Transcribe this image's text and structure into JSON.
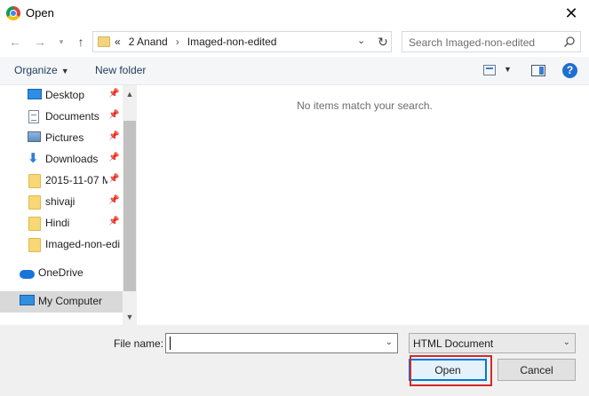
{
  "window": {
    "title": "Open",
    "icon": "chrome-icon",
    "close_icon": "close-icon"
  },
  "navbar": {
    "back_icon": "arrow-left-icon",
    "forward_icon": "arrow-right-icon",
    "recent_icon": "chevron-down-icon",
    "up_icon": "arrow-up-icon",
    "breadcrumb_prefix": "«",
    "breadcrumb": [
      "2 Anand",
      "Imaged-non-edited"
    ],
    "breadcrumb_sep": "›",
    "search_placeholder": "Search Imaged-non-edited"
  },
  "toolbar": {
    "organize_label": "Organize",
    "new_folder_label": "New folder"
  },
  "sidebar": {
    "items": [
      {
        "label": "Desktop",
        "icon": "desktop-icon",
        "pinned": true
      },
      {
        "label": "Documents",
        "icon": "documents-icon",
        "pinned": true
      },
      {
        "label": "Pictures",
        "icon": "pictures-icon",
        "pinned": true
      },
      {
        "label": "Downloads",
        "icon": "downloads-icon",
        "pinned": true
      },
      {
        "label": "2015-11-07 M",
        "icon": "folder-icon",
        "pinned": true
      },
      {
        "label": "shivaji",
        "icon": "folder-icon",
        "pinned": true
      },
      {
        "label": "Hindi",
        "icon": "folder-icon",
        "pinned": true
      },
      {
        "label": "Imaged-non-edi",
        "icon": "folder-icon",
        "pinned": false
      },
      {
        "label": "OneDrive",
        "icon": "onedrive-icon",
        "pinned": false
      },
      {
        "label": "My Computer",
        "icon": "computer-icon",
        "pinned": false
      }
    ]
  },
  "content": {
    "empty_message": "No items match your search."
  },
  "footer": {
    "file_name_label": "File name:",
    "file_name_value": "",
    "file_type_selected": "HTML Document",
    "open_label": "Open",
    "cancel_label": "Cancel"
  },
  "colors": {
    "accent": "#0078d7",
    "highlight_box": "#d22a2a",
    "help": "#1f6fd1"
  }
}
